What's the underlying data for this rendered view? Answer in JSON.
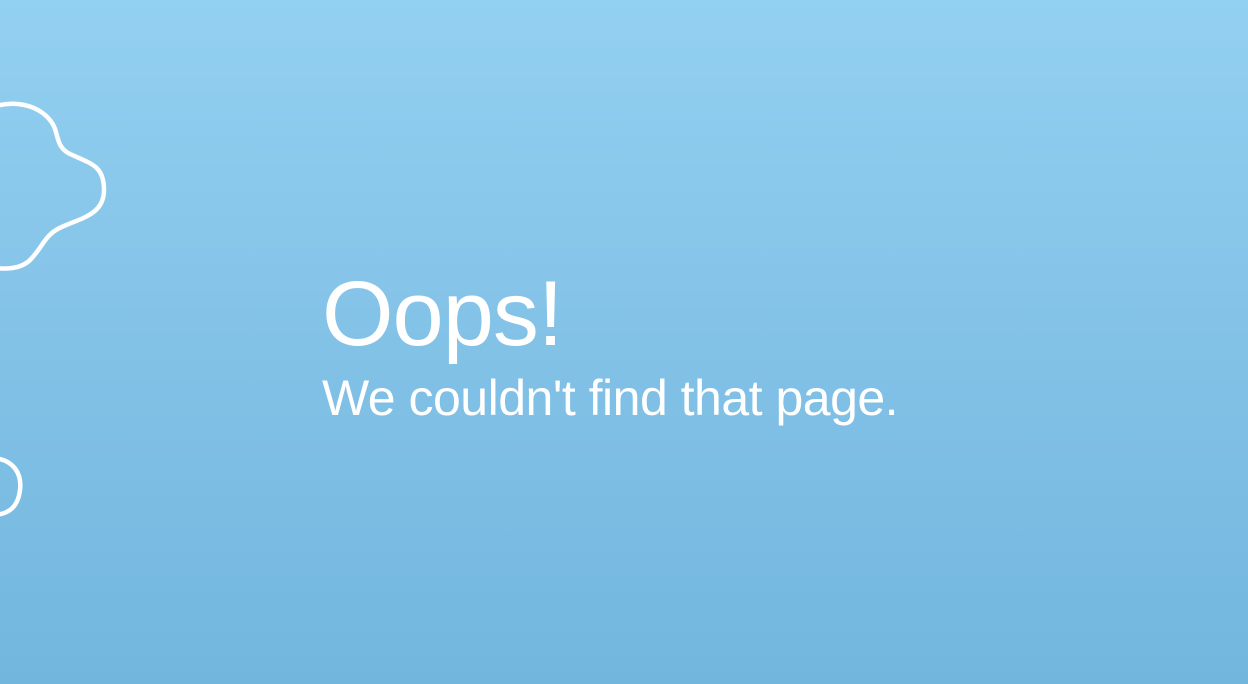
{
  "error_page": {
    "headline": "Oops!",
    "subhead": "We couldn't find that page."
  },
  "decor": {
    "cloud_icon": "cloud-outline-icon",
    "stroke_color": "#ffffff"
  },
  "colors": {
    "background_top": "#93d0f1",
    "background_bottom": "#72b6de",
    "text": "#ffffff"
  }
}
